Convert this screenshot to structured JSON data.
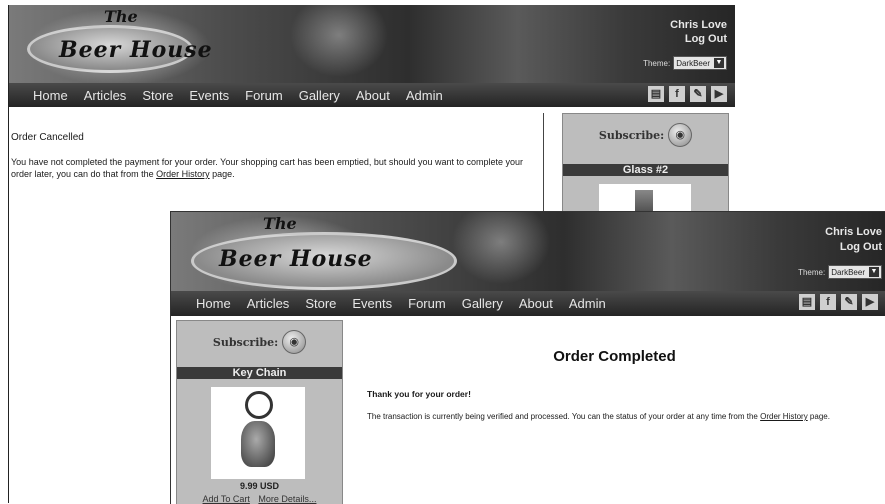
{
  "site": {
    "logo_the": "The",
    "logo_name": "Beer House"
  },
  "user": {
    "name": "Chris Love",
    "logout": "Log Out"
  },
  "theme": {
    "label": "Theme:",
    "value": "DarkBeer"
  },
  "nav": [
    "Home",
    "Articles",
    "Store",
    "Events",
    "Forum",
    "Gallery",
    "About",
    "Admin"
  ],
  "social_icons": [
    "rss-square-icon",
    "facebook-icon",
    "social-icon",
    "youtube-icon"
  ],
  "cancelled": {
    "title": "Order Cancelled",
    "message": "You have not completed the payment for your order. Your shopping cart has been emptied, but should you want to complete your order later, you can do that from the",
    "link": "Order History",
    "suffix": "page."
  },
  "sidebar1": {
    "subscribe": "Subscribe:",
    "product": "Glass #2"
  },
  "completed": {
    "heading": "Order Completed",
    "thanks": "Thank you for your order!",
    "message": "The transaction is currently being verified and processed. You can the status of your order at any time from the",
    "link": "Order History",
    "suffix": "page."
  },
  "sidebar2": {
    "subscribe": "Subscribe:",
    "product": "Key Chain",
    "price": "9.99 USD",
    "add_to_cart": "Add To Cart",
    "more_details": "More Details..."
  }
}
